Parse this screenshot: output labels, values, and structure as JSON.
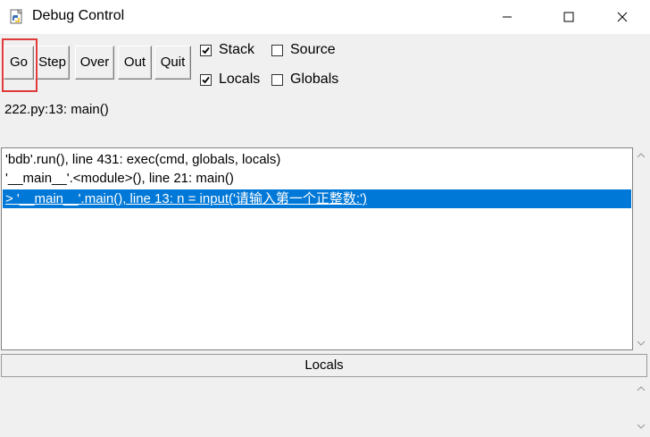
{
  "window": {
    "title": "Debug Control",
    "icons": {
      "app": "python-idle-icon",
      "minimize": "minimize-icon",
      "maximize": "maximize-icon",
      "close": "close-icon"
    }
  },
  "toolbar": {
    "buttons": [
      {
        "label": "Go"
      },
      {
        "label": "Step"
      },
      {
        "label": "Over"
      },
      {
        "label": "Out"
      },
      {
        "label": "Quit"
      }
    ]
  },
  "options": {
    "stack": {
      "label": "Stack",
      "checked": true
    },
    "source": {
      "label": "Source",
      "checked": false
    },
    "locals": {
      "label": "Locals",
      "checked": true
    },
    "globals": {
      "label": "Globals",
      "checked": false
    }
  },
  "status": {
    "location": "222.py:13: main()"
  },
  "stack_frames": [
    {
      "text": "'bdb'.run(), line 431: exec(cmd, globals, locals)",
      "selected": false
    },
    {
      "text": "'__main__'.<module>(), line 21: main()",
      "selected": false
    },
    {
      "text": "> '__main__'.main(), line 13: n = input('请输入第一个正整数:')",
      "selected": true
    }
  ],
  "locals_panel": {
    "header": "Locals"
  },
  "colors": {
    "selection": "#0078d7",
    "highlight_box": "#e03a3a"
  }
}
